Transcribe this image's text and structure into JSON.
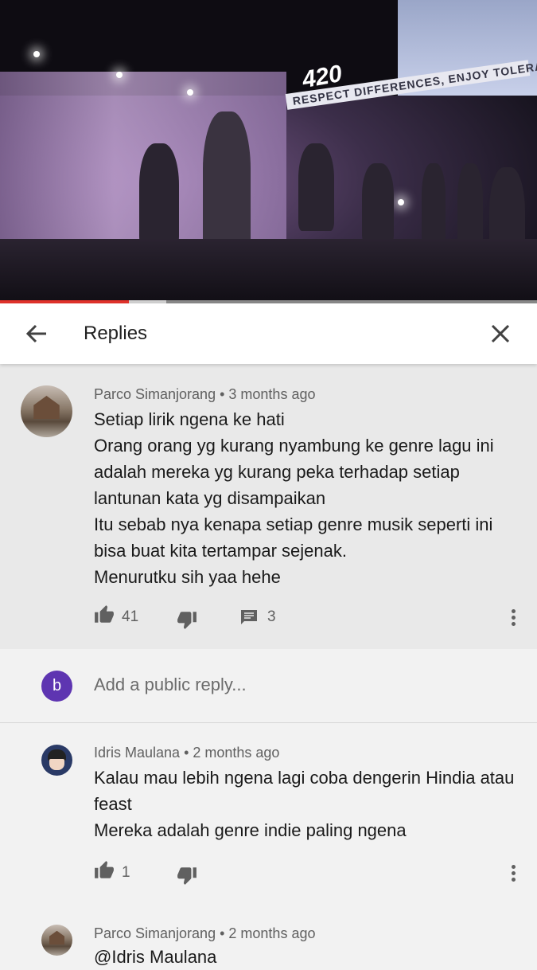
{
  "video": {
    "banner_text": "RESPECT DIFFERENCES, ENJOY TOLERANCE",
    "logo_text": "420",
    "played_fraction": 0.24,
    "buffered_fraction": 0.31
  },
  "header": {
    "title": "Replies",
    "back_icon": "arrow-left-icon",
    "close_icon": "close-icon"
  },
  "parent_comment": {
    "author": "Parco Simanjorang",
    "time": "3 months ago",
    "text": "Setiap lirik ngena ke hati\nOrang orang yg kurang nyambung ke genre lagu ini adalah mereka yg kurang peka terhadap setiap lantunan kata yg disampaikan\nItu sebab nya kenapa setiap genre musik seperti ini bisa buat kita tertampar sejenak.\nMenurutku sih yaa hehe",
    "likes": "41",
    "replies": "3"
  },
  "reply_box": {
    "avatar_letter": "b",
    "avatar_color": "#5e35b1",
    "placeholder": "Add a public reply..."
  },
  "replies": [
    {
      "author": "Idris Maulana",
      "time": "2 months ago",
      "text": "Kalau mau lebih ngena lagi coba dengerin Hindia atau feast\nMereka adalah genre indie paling ngena",
      "likes": "1"
    },
    {
      "author": "Parco Simanjorang",
      "time": "2 months ago",
      "text": "@Idris Maulana"
    }
  ],
  "colors": {
    "accent_red": "#e0322b",
    "separator": " • "
  }
}
